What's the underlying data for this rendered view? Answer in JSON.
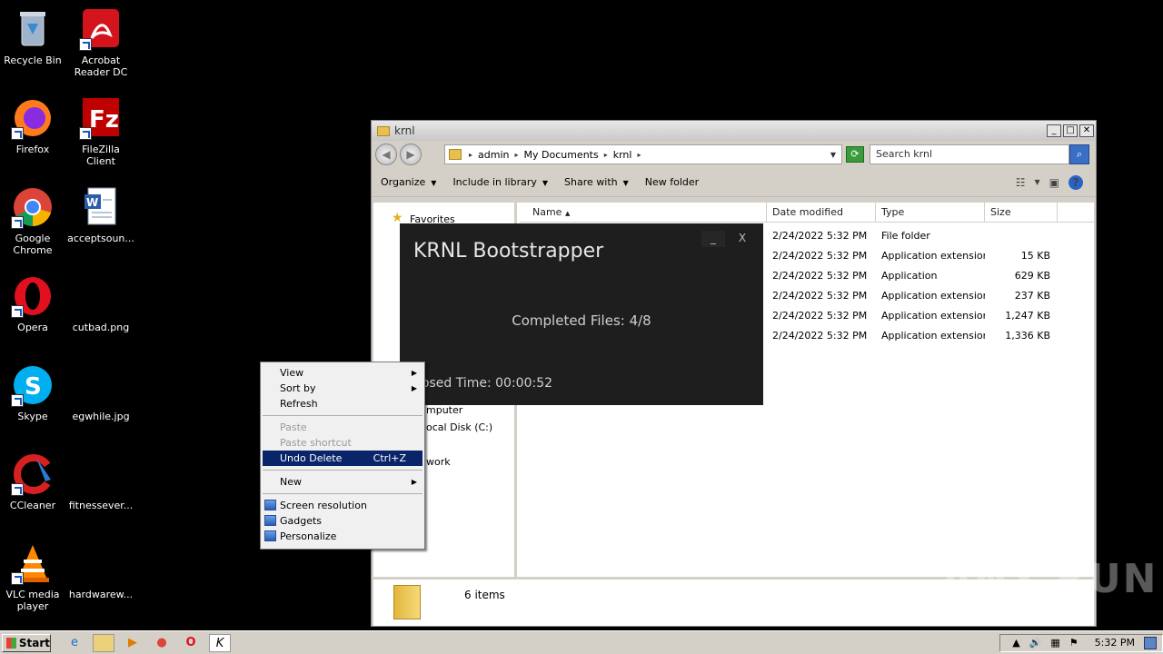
{
  "desktop": {
    "icons": [
      {
        "label": "Recycle Bin",
        "icon": "recycle-bin-icon"
      },
      {
        "label": "Acrobat Reader DC",
        "icon": "acrobat-icon"
      },
      {
        "label": "Firefox",
        "icon": "firefox-icon"
      },
      {
        "label": "FileZilla Client",
        "icon": "filezilla-icon"
      },
      {
        "label": "Google Chrome",
        "icon": "chrome-icon"
      },
      {
        "label": "acceptsoun...",
        "icon": "word-document-icon"
      },
      {
        "label": "Opera",
        "icon": "opera-icon"
      },
      {
        "label": "cutbad.png",
        "icon": "image-file-icon"
      },
      {
        "label": "Skype",
        "icon": "skype-icon"
      },
      {
        "label": "egwhile.jpg",
        "icon": "image-file-icon"
      },
      {
        "label": "CCleaner",
        "icon": "ccleaner-icon"
      },
      {
        "label": "fitnessever...",
        "icon": "file-icon"
      },
      {
        "label": "VLC media player",
        "icon": "vlc-icon"
      },
      {
        "label": "hardwarew...",
        "icon": "file-icon"
      }
    ]
  },
  "explorer": {
    "title": "krnl",
    "address": [
      "admin",
      "My Documents",
      "krnl"
    ],
    "search_placeholder": "Search krnl",
    "toolbar": {
      "organize": "Organize",
      "include_library": "Include in library",
      "share_with": "Share with",
      "new_folder": "New folder"
    },
    "nav": {
      "favorites": "Favorites",
      "computer": "mputer",
      "local_disk": "ocal Disk (C:)",
      "network": "work"
    },
    "columns": {
      "name": "Name",
      "date": "Date modified",
      "type": "Type",
      "size": "Size"
    },
    "files": [
      {
        "date": "2/24/2022 5:32 PM",
        "type": "File folder",
        "size": ""
      },
      {
        "date": "2/24/2022 5:32 PM",
        "type": "Application extension",
        "size": "15 KB"
      },
      {
        "date": "2/24/2022 5:32 PM",
        "type": "Application",
        "size": "629 KB"
      },
      {
        "date": "2/24/2022 5:32 PM",
        "type": "Application extension",
        "size": "237 KB"
      },
      {
        "date": "2/24/2022 5:32 PM",
        "type": "Application extension",
        "size": "1,247 KB"
      },
      {
        "date": "2/24/2022 5:32 PM",
        "type": "Application extension",
        "size": "1,336 KB"
      }
    ],
    "status": "6 items"
  },
  "krnl": {
    "title": "KRNL Bootstrapper",
    "minimize": "_",
    "close": "X",
    "status": "Completed Files: 4/8",
    "elapsed": "apsed Time: 00:00:52"
  },
  "context_menu": {
    "view": "View",
    "sort_by": "Sort by",
    "refresh": "Refresh",
    "paste": "Paste",
    "paste_shortcut": "Paste shortcut",
    "undo_delete": "Undo Delete",
    "undo_shortcut": "Ctrl+Z",
    "new": "New",
    "screen_resolution": "Screen resolution",
    "gadgets": "Gadgets",
    "personalize": "Personalize"
  },
  "taskbar": {
    "start": "Start",
    "clock": "5:32 PM"
  },
  "watermark": "ANY RUN"
}
